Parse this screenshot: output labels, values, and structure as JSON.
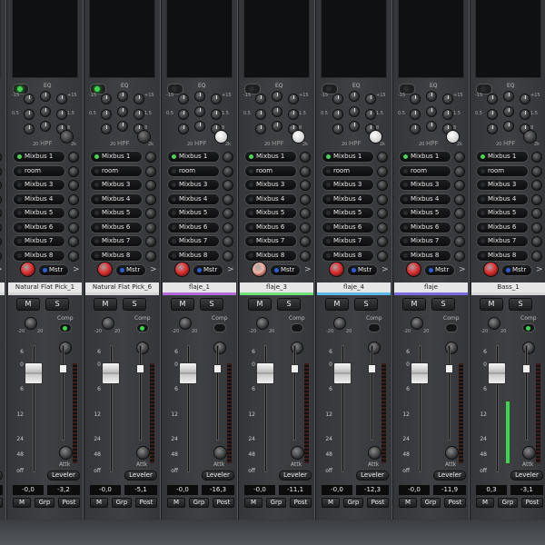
{
  "eq_label": "EQ",
  "hpf_label": "HPF",
  "eq_ticks": [
    "-15",
    "+15",
    "0.5",
    "1.5",
    "8"
  ],
  "hpf_ticks": [
    "20",
    "2k"
  ],
  "gain_ticks": [
    "-20",
    "20"
  ],
  "comp_label": "Comp",
  "attk_label": "Attk",
  "leveler_label": "Leveler",
  "mute_label": "M",
  "solo_label": "S",
  "mstr_label": "Mstr",
  "grp_label": "Grp",
  "post_label": "Post",
  "fader_scale": [
    "6",
    "0",
    "6",
    "12",
    "24",
    "48",
    "off"
  ],
  "channels": [
    {
      "name": "",
      "color": "#d6d6d6",
      "readout_left": "-0,0",
      "readout_right": "-3,2",
      "sends": [
        "Mixbus 1",
        "room",
        "Mixbus 3",
        "Mixbus 4",
        "Mixbus 5",
        "Mixbus 6",
        "Mixbus 7",
        "Mixbus 8"
      ],
      "first_send_on": true,
      "eq_on": true,
      "pan_color": "#e03030",
      "hpf_white": false,
      "comp_on": false
    },
    {
      "name": "Natural Flat Pick_1",
      "color": "#d6d6d6",
      "readout_left": "-0,0",
      "readout_right": "-3,2",
      "sends": [
        "Mixbus 1",
        "room",
        "Mixbus 3",
        "Mixbus 4",
        "Mixbus 5",
        "Mixbus 6",
        "Mixbus 7",
        "Mixbus 8"
      ],
      "first_send_on": true,
      "eq_on": true,
      "pan_color": "#e03030",
      "hpf_white": false,
      "comp_on": true
    },
    {
      "name": "Natural Flat Pick_6",
      "color": "#d6d6d6",
      "readout_left": "-0,0",
      "readout_right": "-5,1",
      "sends": [
        "Mixbus 1",
        "room",
        "Mixbus 3",
        "Mixbus 4",
        "Mixbus 5",
        "Mixbus 6",
        "Mixbus 7",
        "Mixbus 8"
      ],
      "first_send_on": true,
      "eq_on": true,
      "pan_color": "#e03030",
      "hpf_white": false,
      "comp_on": true
    },
    {
      "name": "flaje_1",
      "color": "#b46ad8",
      "readout_left": "-0,0",
      "readout_right": "-16,3",
      "sends": [
        "Mixbus 1",
        "room",
        "Mixbus 3",
        "Mixbus 4",
        "Mixbus 5",
        "Mixbus 6",
        "Mixbus 7",
        "Mixbus 8"
      ],
      "first_send_on": true,
      "eq_on": false,
      "pan_color": "#e03030",
      "hpf_white": true,
      "comp_on": false
    },
    {
      "name": "flaje_3",
      "color": "#6fe07a",
      "readout_left": "-0,0",
      "readout_right": "-11,1",
      "sends": [
        "Mixbus 1",
        "room",
        "Mixbus 3",
        "Mixbus 4",
        "Mixbus 5",
        "Mixbus 6",
        "Mixbus 7",
        "Mixbus 8"
      ],
      "first_send_on": true,
      "eq_on": false,
      "pan_color": "#f0b4a4",
      "hpf_white": true,
      "comp_on": false
    },
    {
      "name": "flaje_4",
      "color": "#5ab8e8",
      "readout_left": "-0,0",
      "readout_right": "-12,3",
      "sends": [
        "Mixbus 1",
        "room",
        "Mixbus 3",
        "Mixbus 4",
        "Mixbus 5",
        "Mixbus 6",
        "Mixbus 7",
        "Mixbus 8"
      ],
      "first_send_on": true,
      "eq_on": false,
      "pan_color": "#e03030",
      "hpf_white": true,
      "comp_on": false
    },
    {
      "name": "flaje",
      "color": "#7a6ae0",
      "readout_left": "-0,0",
      "readout_right": "-11,9",
      "sends": [
        "Mixbus 1",
        "room",
        "Mixbus 3",
        "Mixbus 4",
        "Mixbus 5",
        "Mixbus 6",
        "Mixbus 7",
        "Mixbus 8"
      ],
      "first_send_on": true,
      "eq_on": false,
      "pan_color": "#e03030",
      "hpf_white": true,
      "comp_on": false
    },
    {
      "name": "Bass_1",
      "color": "#d6d6d6",
      "readout_left": "0,3",
      "readout_right": "-3,1",
      "sends": [
        "Mixbus 1",
        "room",
        "Mixbus 3",
        "Mixbus 4",
        "Mixbus 5",
        "Mixbus 6",
        "Mixbus 7",
        "Mixbus 8"
      ],
      "first_send_on": true,
      "eq_on": false,
      "pan_color": "#e03030",
      "hpf_white": false,
      "comp_on": true,
      "meter_level": 0.62
    }
  ]
}
